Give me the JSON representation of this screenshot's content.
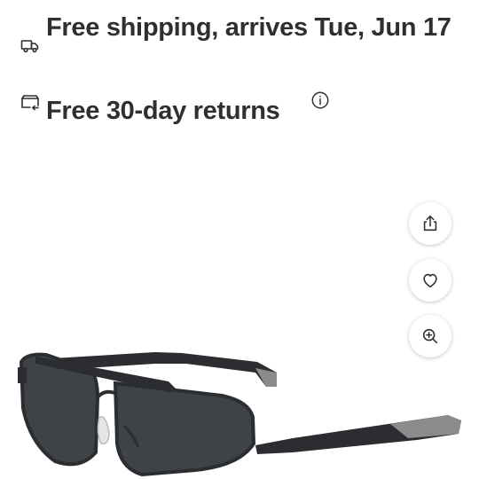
{
  "fulfillment": {
    "shipping": {
      "icon": "truck-icon",
      "text": "Free shipping, arrives Tue, Jun 17"
    },
    "returns": {
      "icon": "returns-icon",
      "text": "Free 30-day returns",
      "info_icon": "info-icon"
    }
  },
  "image_actions": [
    {
      "icon": "share-icon"
    },
    {
      "icon": "heart-icon"
    },
    {
      "icon": "zoom-in-icon"
    }
  ],
  "product_image": {
    "subject": "sunglasses",
    "frame_color": "#2b2d30",
    "lens_color": "#3d4347",
    "temple_tip_color": "#8a8b8d"
  }
}
